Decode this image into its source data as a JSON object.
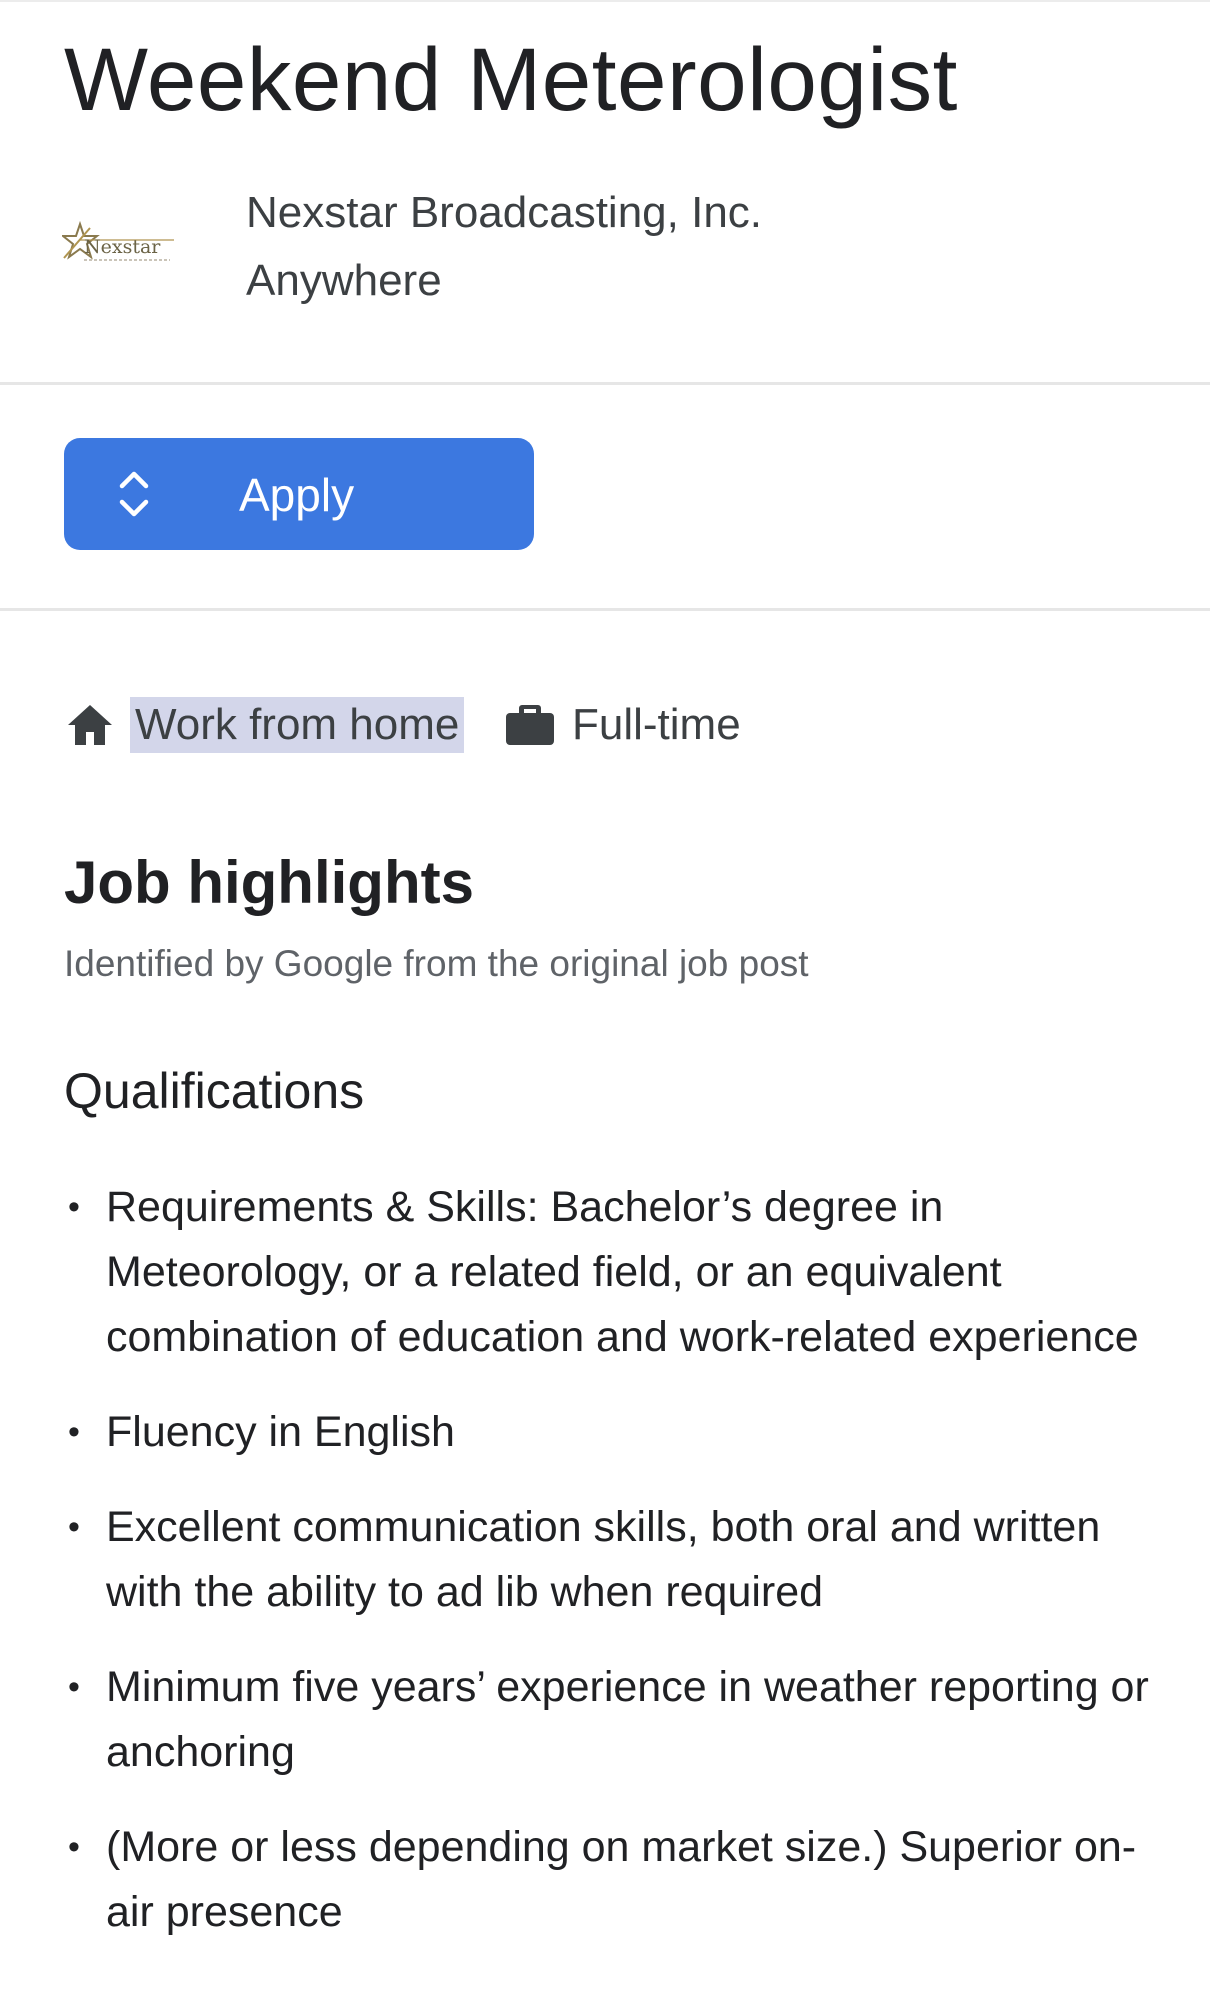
{
  "job": {
    "title": "Weekend Meterologist",
    "company": "Nexstar Broadcasting, Inc.",
    "location": "Anywhere",
    "logo_text": "Nexstar"
  },
  "apply": {
    "label": "Apply",
    "icon": "chevron-up-down-icon",
    "color": "#3c78e0"
  },
  "chips": {
    "work_mode": {
      "icon": "home-icon",
      "label": "Work from home",
      "highlight": "#d3d6ea"
    },
    "schedule": {
      "icon": "briefcase-icon",
      "label": "Full-time"
    }
  },
  "highlights": {
    "title": "Job highlights",
    "subtitle": "Identified by Google from the original job post",
    "qualifications_title": "Qualifications",
    "bullet": "•",
    "qualifications": [
      "Requirements & Skills: Bachelor’s degree in Meteorology, or a related field, or an equivalent combination of education and work-related experience",
      "Fluency in English",
      "Excellent communication skills, both oral and written with the ability to ad lib when required",
      "Minimum five years’ experience in weather reporting or anchoring",
      "(More or less depending on market size.) Superior on-air presence"
    ]
  }
}
